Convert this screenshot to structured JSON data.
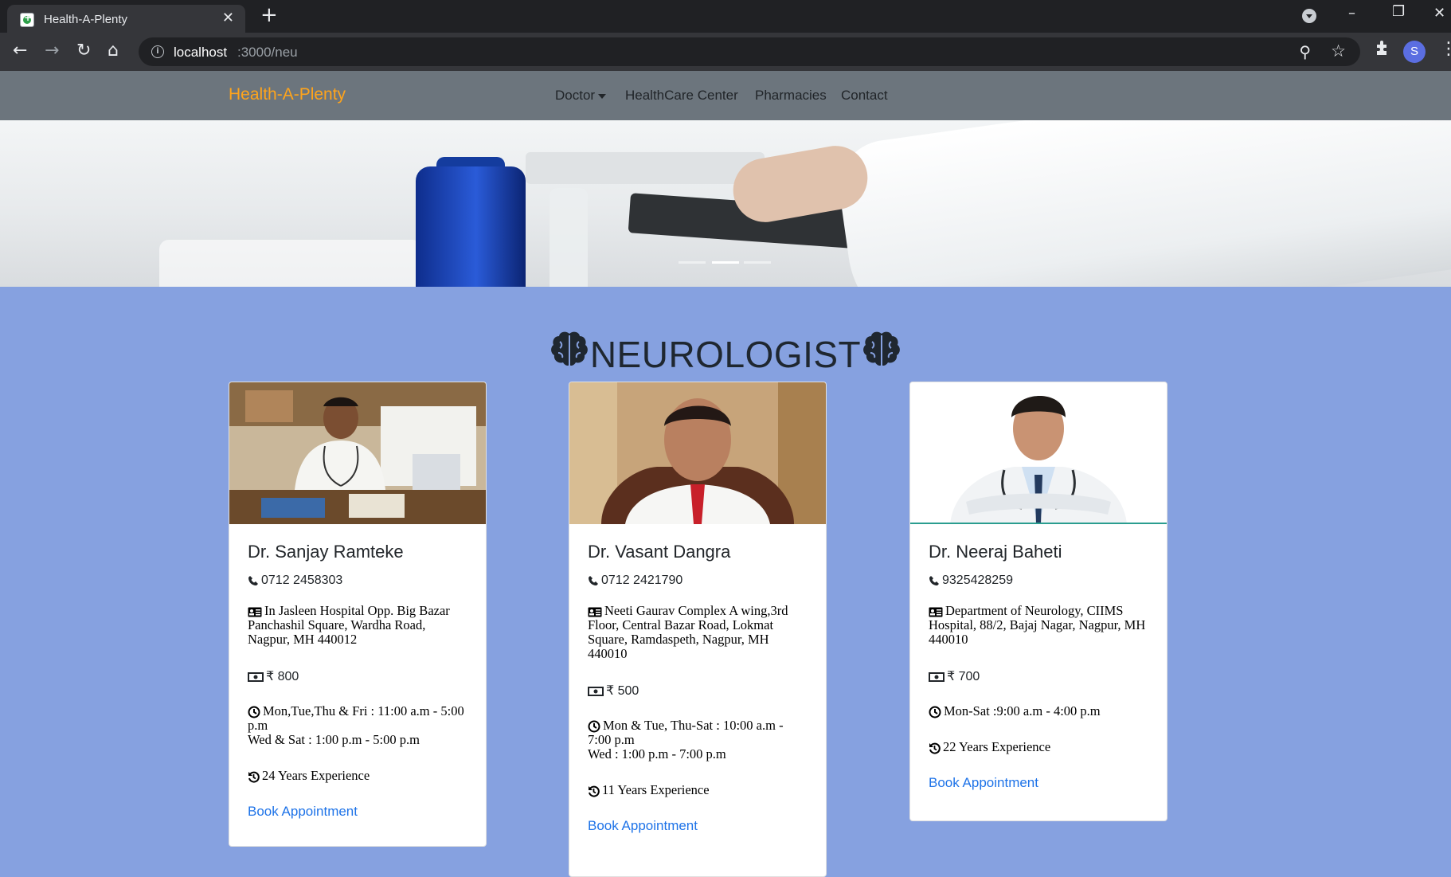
{
  "browser": {
    "tab_title": "Health-A-Plenty",
    "tab_close": "✕",
    "new_tab": "+",
    "url_host": "localhost",
    "url_path": ":3000/neu"
  },
  "navbar": {
    "brand": "Health-A-Plenty",
    "items": [
      "Doctor",
      "HealthCare Center",
      "Pharmacies",
      "Contact"
    ],
    "brand_color": "#ffa41b"
  },
  "hero": {
    "slides": 3,
    "active_slide": 2
  },
  "section": {
    "title": "NEUROLOGIST"
  },
  "doctors": [
    {
      "name": "Dr. Sanjay Ramteke",
      "phone": "0712 2458303",
      "address": "In Jasleen Hospital Opp. Big Bazar Panchashil Square, Wardha Road, Nagpur, MH 440012",
      "fee": "₹ 800",
      "timing_1": "Mon,Tue,Thu & Fri : 11:00 a.m - 5:00 p.m",
      "timing_2": "Wed & Sat : 1:00 p.m - 5:00 p.m",
      "experience": "24 Years Experience",
      "action": "Book Appointment"
    },
    {
      "name": "Dr. Vasant Dangra",
      "phone": "0712 2421790",
      "address": "Neeti Gaurav Complex A wing,3rd Floor, Central Bazar Road, Lokmat Square, Ramdaspeth, Nagpur, MH 440010",
      "fee": "₹ 500",
      "timing_1": "Mon & Tue, Thu-Sat : 10:00 a.m - 7:00 p.m",
      "timing_2": "Wed : 1:00 p.m - 7:00 p.m",
      "experience": "11 Years Experience",
      "action": "Book Appointment"
    },
    {
      "name": "Dr. Neeraj Baheti",
      "phone": "9325428259",
      "address": "Department of Neurology, CIIMS Hospital, 88/2, Bajaj Nagar, Nagpur, MH 440010",
      "fee": "₹ 700",
      "timing_1": "Mon-Sat :9:00 a.m - 4:00 p.m",
      "experience": "22 Years Experience",
      "action": "Book Appointment"
    }
  ],
  "colors": {
    "page_bg": "#86a1e0",
    "navbar_bg": "#6c757d",
    "link": "#1e73e8"
  }
}
